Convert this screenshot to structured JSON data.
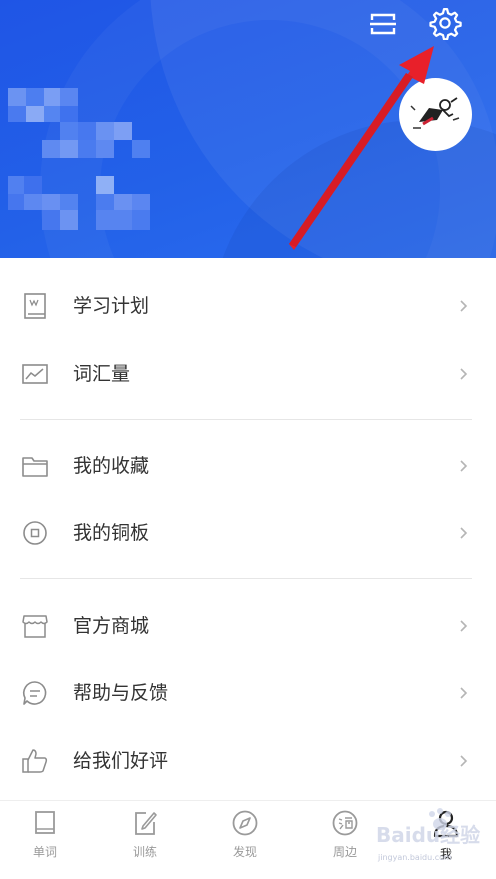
{
  "header": {
    "scan_icon": "scan-icon",
    "settings_icon": "gear-icon",
    "avatar_icon": "avatar-superhero-icon"
  },
  "menu": {
    "group1": [
      {
        "label": "学习计划",
        "icon": "book-icon"
      },
      {
        "label": "词汇量",
        "icon": "line-chart-icon"
      }
    ],
    "group2": [
      {
        "label": "我的收藏",
        "icon": "folder-icon"
      },
      {
        "label": "我的铜板",
        "icon": "coin-icon"
      }
    ],
    "group3": [
      {
        "label": "官方商城",
        "icon": "store-icon"
      },
      {
        "label": "帮助与反馈",
        "icon": "chat-icon"
      },
      {
        "label": "给我们好评",
        "icon": "thumbs-up-icon"
      }
    ]
  },
  "tabs": [
    {
      "label": "单词",
      "icon": "book-icon"
    },
    {
      "label": "训练",
      "icon": "edit-icon"
    },
    {
      "label": "发现",
      "icon": "compass-icon"
    },
    {
      "label": "周边",
      "icon": "tao-icon"
    },
    {
      "label": "我",
      "icon": "person-icon",
      "active": true
    }
  ],
  "watermark": {
    "text": "Baidu经验",
    "sub": "jingyan.baidu.com"
  },
  "colors": {
    "header_blue": "#2361e8",
    "arrow_red": "#e8202a",
    "text": "#333333",
    "icon_gray": "#8c8c8c"
  }
}
